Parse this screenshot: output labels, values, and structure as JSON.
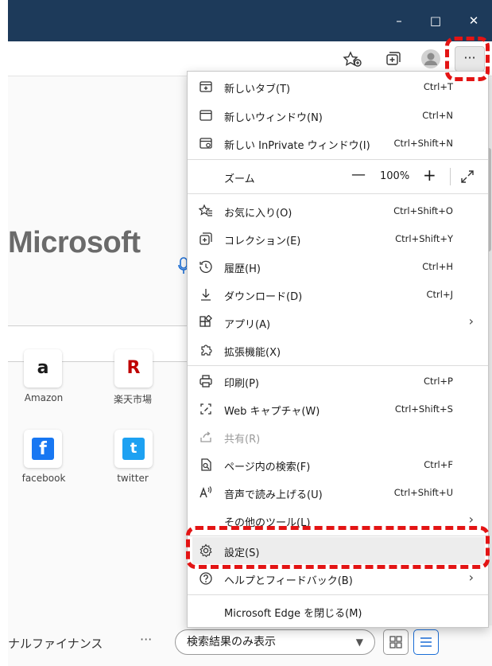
{
  "window": {
    "minimize": "–",
    "restore": "□",
    "close": "✕"
  },
  "toolbar": {
    "more_label": "···"
  },
  "page": {
    "logo": "Microsoft",
    "tiles": [
      {
        "label": "Amazon",
        "glyph": "a"
      },
      {
        "label": "楽天市場",
        "glyph": "R"
      },
      {
        "label": "facebook",
        "glyph": "f"
      },
      {
        "label": "twitter",
        "glyph": "t"
      }
    ],
    "bottom_text": "ナルファイナンス",
    "bottom_ellipsis": "···",
    "bottom_select": "検索結果のみ表示"
  },
  "menu": {
    "items": [
      {
        "label": "新しいタブ(T)",
        "shortcut": "Ctrl+T"
      },
      {
        "label": "新しいウィンドウ(N)",
        "shortcut": "Ctrl+N"
      },
      {
        "label": "新しい InPrivate ウィンドウ(I)",
        "shortcut": "Ctrl+Shift+N"
      },
      {
        "label": "お気に入り(O)",
        "shortcut": "Ctrl+Shift+O"
      },
      {
        "label": "コレクション(E)",
        "shortcut": "Ctrl+Shift+Y"
      },
      {
        "label": "履歴(H)",
        "shortcut": "Ctrl+H"
      },
      {
        "label": "ダウンロード(D)",
        "shortcut": "Ctrl+J"
      },
      {
        "label": "アプリ(A)",
        "shortcut": ""
      },
      {
        "label": "拡張機能(X)",
        "shortcut": ""
      },
      {
        "label": "印刷(P)",
        "shortcut": "Ctrl+P"
      },
      {
        "label": "Web キャプチャ(W)",
        "shortcut": "Ctrl+Shift+S"
      },
      {
        "label": "共有(R)",
        "shortcut": ""
      },
      {
        "label": "ページ内の検索(F)",
        "shortcut": "Ctrl+F"
      },
      {
        "label": "音声で読み上げる(U)",
        "shortcut": "Ctrl+Shift+U"
      },
      {
        "label": "その他のツール(L)",
        "shortcut": ""
      },
      {
        "label": "設定(S)",
        "shortcut": ""
      },
      {
        "label": "ヘルプとフィードバック(B)",
        "shortcut": ""
      },
      {
        "label": "Microsoft Edge を閉じる(M)",
        "shortcut": ""
      }
    ],
    "zoom": {
      "label": "ズーム",
      "minus": "—",
      "value": "100%",
      "plus": "+"
    },
    "arrow": "›"
  },
  "colors": {
    "titlebar": "#1d3a5a",
    "highlight": "#e31414"
  }
}
